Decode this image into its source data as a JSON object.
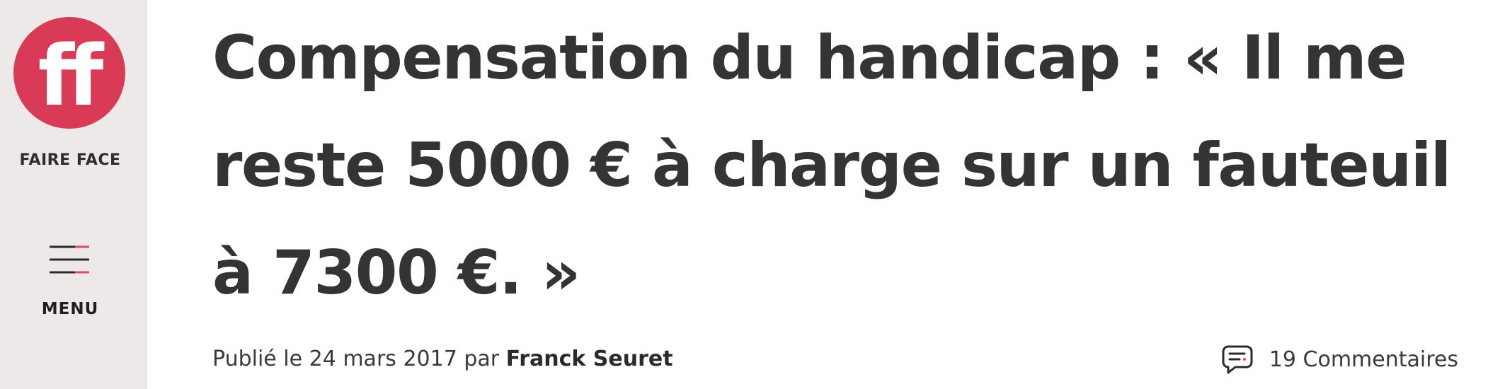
{
  "sidebar": {
    "logo": {
      "text": "ff",
      "icon": "ff-logo-icon",
      "color": "#d93a55"
    },
    "brand_name": "FAIRE FACE",
    "menu": {
      "label": "MENU",
      "icon": "hamburger-menu-icon",
      "accent_color": "#e0485f"
    }
  },
  "article": {
    "title": "Compensation du handicap : « Il me reste 5000 € à charge sur un fauteuil à 7300 €. »",
    "published_prefix": "Publié le",
    "published_date": "24 mars 2017",
    "by": "par",
    "author": "Franck Seuret",
    "comments_label": "19 Commentaires",
    "comments_icon": "comment-bubble-icon"
  },
  "colors": {
    "sidebar_bg": "#ece9e8",
    "text": "#333333",
    "accent": "#d93a55"
  }
}
